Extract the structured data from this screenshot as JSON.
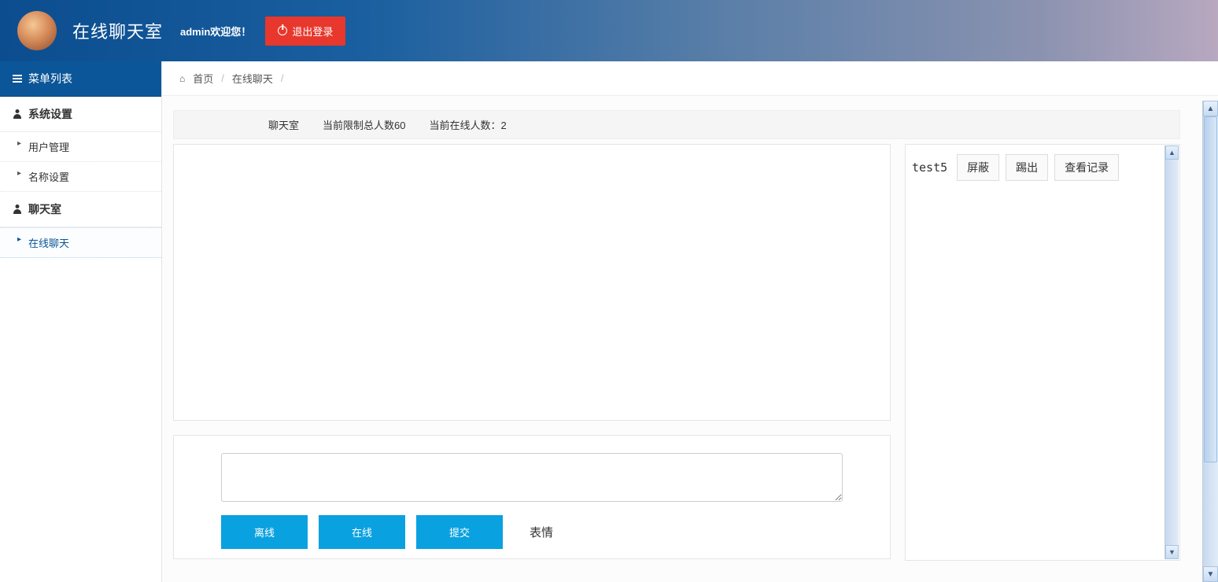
{
  "header": {
    "app_title": "在线聊天室",
    "welcome_text": "admin欢迎您！",
    "logout_label": "退出登录"
  },
  "sidebar": {
    "header": "菜单列表",
    "sections": [
      {
        "title": "系统设置",
        "items": [
          {
            "label": "用户管理"
          },
          {
            "label": "名称设置"
          }
        ]
      },
      {
        "title": "聊天室",
        "items": [
          {
            "label": "在线聊天",
            "active": true
          }
        ]
      }
    ]
  },
  "breadcrumb": {
    "home": "首页",
    "current": "在线聊天"
  },
  "chat": {
    "room_label": "聊天室",
    "limit_label": "当前限制总人数60",
    "online_label": "当前在线人数：2",
    "buttons": {
      "offline": "离线",
      "online": "在线",
      "submit": "提交",
      "emoji": "表情"
    },
    "users": [
      {
        "name": "test5",
        "actions": {
          "block": "屏蔽",
          "kick": "踢出",
          "view_log": "查看记录"
        }
      }
    ]
  }
}
